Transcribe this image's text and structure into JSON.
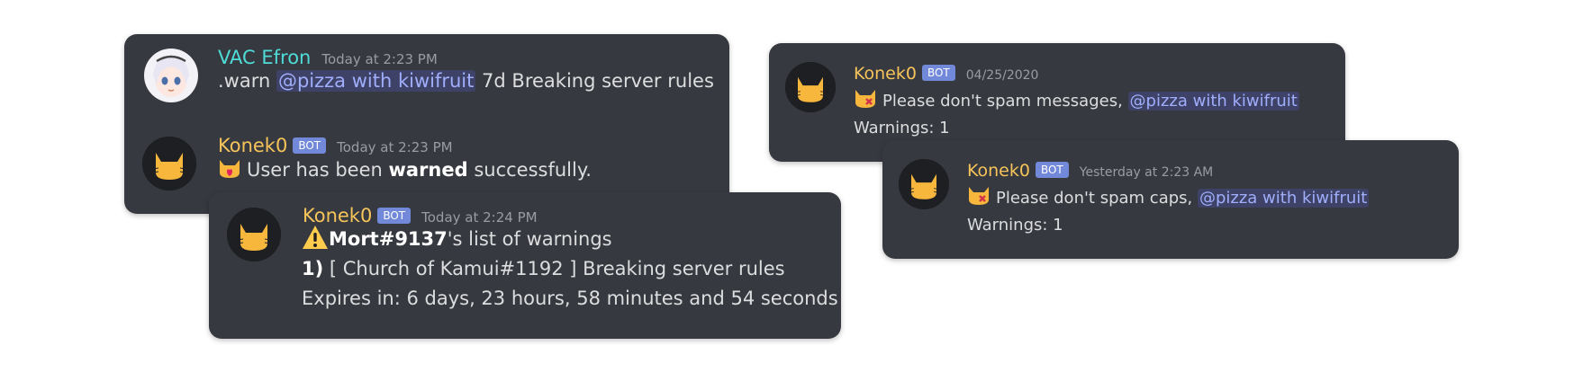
{
  "card1": {
    "msg1": {
      "author": "VAC Efron",
      "time": "Today at 2:23 PM",
      "prefix": ".warn ",
      "mention": "@pizza with kiwifruit",
      "suffix": " 7d Breaking server rules"
    },
    "msg2": {
      "author": "Konek0",
      "badge": "BOT",
      "time": "Today at 2:23 PM",
      "text_before": "User has been ",
      "bold": "warned",
      "text_after": " successfully."
    }
  },
  "card2": {
    "author": "Konek0",
    "badge": "BOT",
    "time": "Today at 2:24 PM",
    "user": "Mort#9137",
    "title_suffix": "'s list of warnings",
    "item_num": "1)",
    "item_text": " [ Church of Kamui#1192 ] Breaking server rules",
    "expires": "Expires in: 6 days, 23 hours, 58 minutes and 54 seconds"
  },
  "card3": {
    "author": "Konek0",
    "badge": "BOT",
    "time": "04/25/2020",
    "text": "Please don't spam messages, ",
    "mention": "@pizza with kiwifruit",
    "warnings": "Warnings: 1"
  },
  "card4": {
    "author": "Konek0",
    "badge": "BOT",
    "time": "Yesterday at 2:23 AM",
    "text": "Please don't spam caps, ",
    "mention": "@pizza with kiwifruit",
    "warnings": "Warnings: 1"
  },
  "colors": {
    "card_bg": "#36393f",
    "bot_name": "#f6c45a",
    "user_name": "#4fdcd8",
    "mention": "#a0aefc",
    "badge": "#7289da"
  },
  "icons": [
    "anime-avatar-icon",
    "cat-avatar-icon",
    "cat-heart-emoji-icon",
    "cat-angry-emoji-icon",
    "warning-icon"
  ]
}
